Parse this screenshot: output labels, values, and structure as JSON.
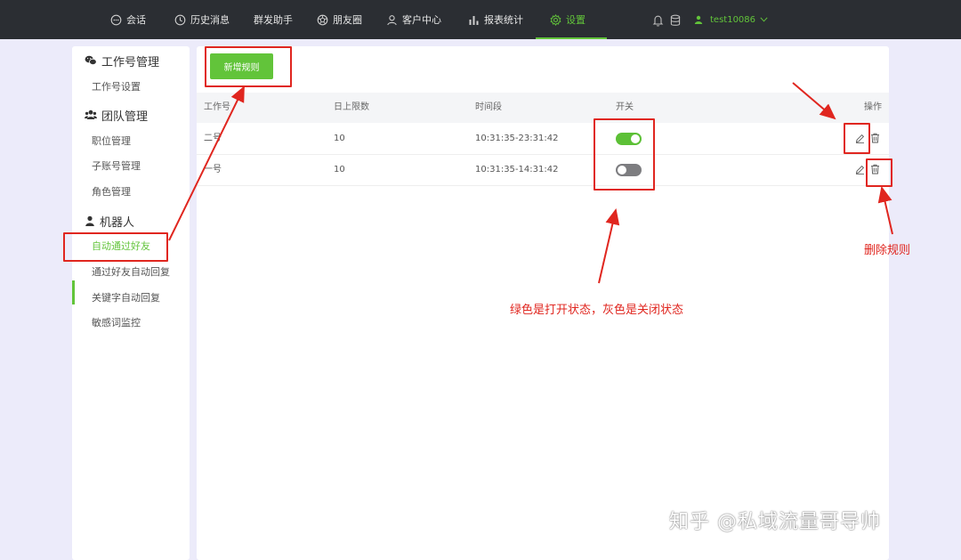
{
  "nav": {
    "items": [
      {
        "label": "会话",
        "icon": "chat-bubble-icon"
      },
      {
        "label": "历史消息",
        "icon": "clock-icon"
      },
      {
        "label": "群发助手",
        "icon": ""
      },
      {
        "label": "朋友圈",
        "icon": "aperture-icon"
      },
      {
        "label": "客户中心",
        "icon": "person-icon"
      },
      {
        "label": "报表统计",
        "icon": "bar-chart-icon"
      },
      {
        "label": "设置",
        "icon": "gear-icon"
      }
    ],
    "active": "设置",
    "username": "test10086",
    "accent": "#62c43a"
  },
  "sidebar": {
    "groups": [
      {
        "title": "工作号管理",
        "icon": "wechat-icon",
        "items": [
          "工作号设置"
        ]
      },
      {
        "title": "团队管理",
        "icon": "team-icon",
        "items": [
          "职位管理",
          "子账号管理",
          "角色管理"
        ]
      },
      {
        "title": "机器人",
        "icon": "robot-icon",
        "items": [
          "自动通过好友",
          "通过好友自动回复",
          "关键字自动回复",
          "敏感词监控"
        ]
      }
    ],
    "active_item": "自动通过好友"
  },
  "main": {
    "add_button": "新增规则",
    "columns": [
      "工作号",
      "日上限数",
      "时间段",
      "开关",
      "操作"
    ],
    "rows": [
      {
        "account": "二号",
        "daily_limit": "10",
        "time_range": "10:31:35-23:31:42",
        "switch_on": true
      },
      {
        "account": "一号",
        "daily_limit": "10",
        "time_range": "10:31:35-14:31:42",
        "switch_on": false
      }
    ]
  },
  "annotations": {
    "delete_rule": "删除规则",
    "switch_note": "绿色是打开状态，灰色是关闭状态",
    "color": "#e0261f"
  },
  "watermark": "知乎 @私域流量哥导帅"
}
